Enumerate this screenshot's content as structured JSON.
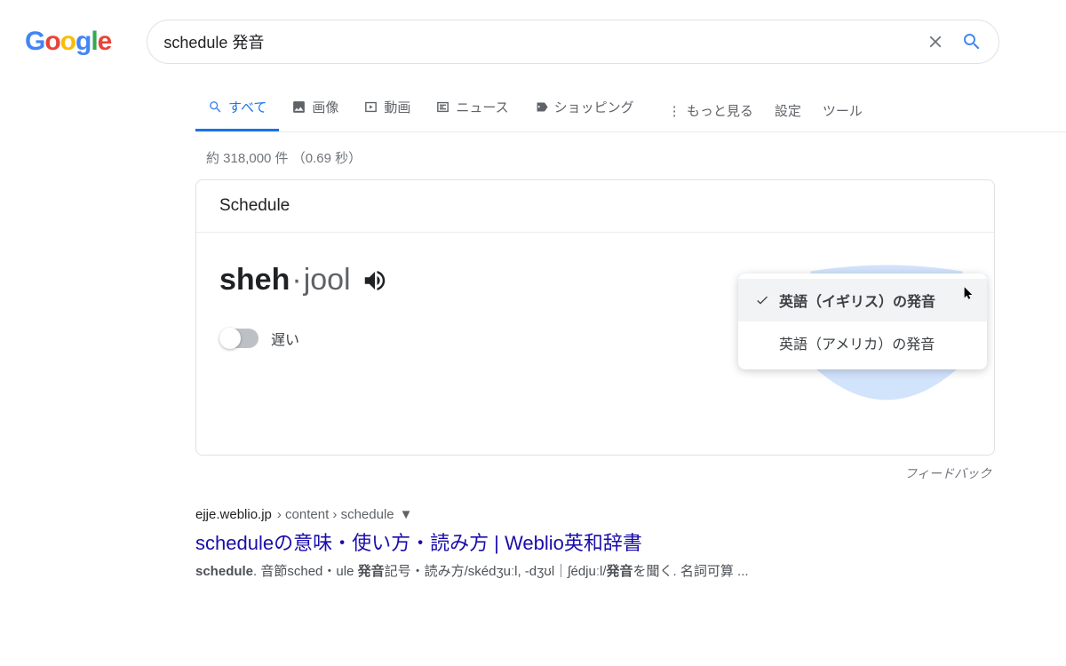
{
  "logo": "Google",
  "search": {
    "query": "schedule 発音"
  },
  "tabs": {
    "all": "すべて",
    "images": "画像",
    "videos": "動画",
    "news": "ニュース",
    "shopping": "ショッピング",
    "more": "もっと見る",
    "settings": "設定",
    "tools": "ツール"
  },
  "stats": "約 318,000 件 （0.69 秒）",
  "card": {
    "title": "Schedule",
    "pron_syllable1": "sheh",
    "pron_syllable2": "jool",
    "toggle_label": "遅い",
    "dropdown": {
      "selected": "英語（イギリス）の発音",
      "other": "英語（アメリカ）の発音"
    }
  },
  "feedback": "フィードバック",
  "result1": {
    "domain": "ejje.weblio.jp",
    "path": " › content › schedule",
    "title": "scheduleの意味・使い方・読み方 | Weblio英和辞書",
    "snippet_prefix_bold": "schedule",
    "snippet_mid1": ". 音節sched・ule ",
    "snippet_bold2": "発音",
    "snippet_mid2": "記号・読み方/skédʒuːl, ‐dʒʊl｜ʃédjuːl/",
    "snippet_bold3": "発音",
    "snippet_tail": "を聞く. 名詞可算 ..."
  }
}
